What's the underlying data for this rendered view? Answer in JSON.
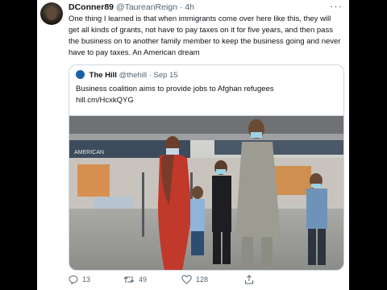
{
  "tweet": {
    "display_name": "DConner89",
    "handle": "@TaureanReign",
    "timestamp": "4h",
    "text": "One thing I learned is that when immigrants come over here like this, they will get all kinds of grants, not have to pay taxes on it for five years, and then pass the business on to another family member to keep the business going and never have to pay taxes. An American dream"
  },
  "quote": {
    "source_name": "The Hill",
    "source_handle": "@thehill",
    "date": "Sep 15",
    "headline": "Business coalition aims to provide jobs to Afghan refugees",
    "link": "hill.cm/HcxkQYG",
    "photo_sign_text": "AMERICAN"
  },
  "actions": {
    "replies": "13",
    "retweets": "49",
    "likes": "128"
  },
  "colors": {
    "text_primary": "#0f1419",
    "text_secondary": "#536471",
    "border": "#cfd9de",
    "hill_logo": "#1b5faa"
  },
  "icons": [
    "more-icon",
    "reply-icon",
    "retweet-icon",
    "like-icon",
    "share-icon"
  ]
}
